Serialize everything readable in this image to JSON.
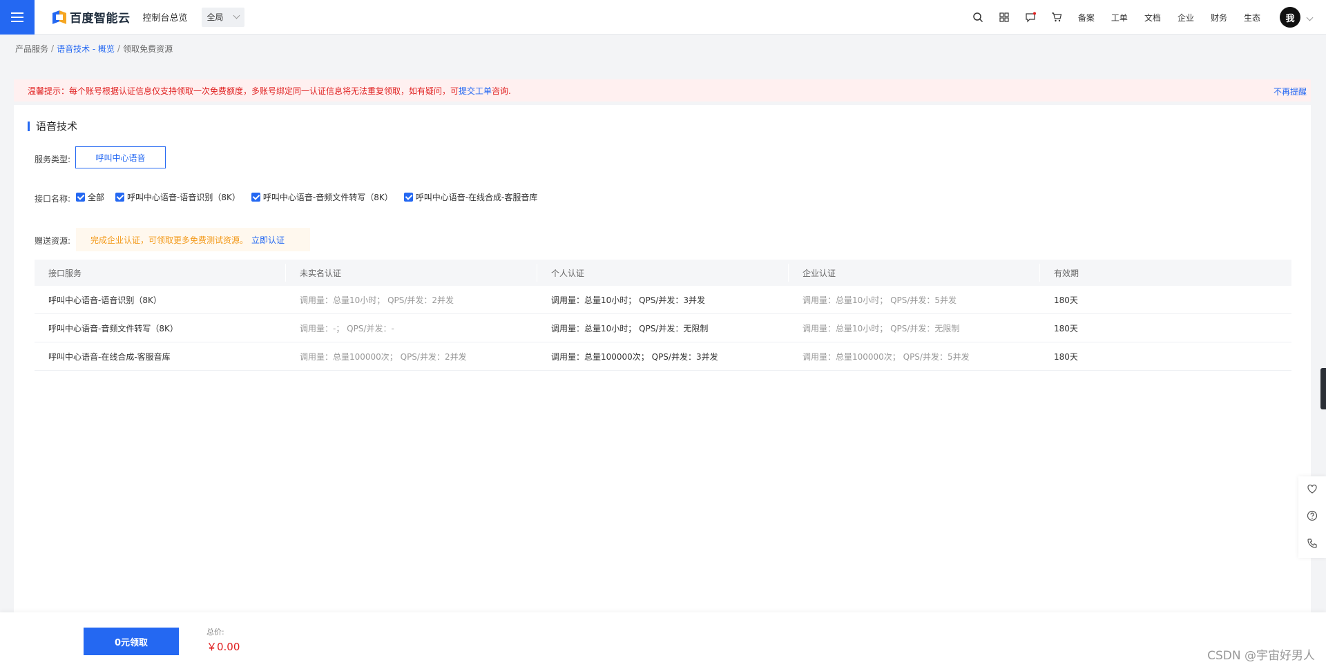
{
  "topbar": {
    "logo_text": "百度智能云",
    "console_link": "控制台总览",
    "region": "全局",
    "nav_links": [
      "备案",
      "工单",
      "文档",
      "企业",
      "财务",
      "生态"
    ],
    "avatar": "我"
  },
  "breadcrumb": {
    "item1": "产品服务",
    "item2": "语音技术 - 概览",
    "item3": "领取免费资源"
  },
  "notice": {
    "text_before": "温馨提示：每个账号根据认证信息仅支持领取一次免费额度，多账号绑定同一认证信息将无法重复领取，如有疑问，可",
    "link": "提交工单",
    "text_after": "咨询.",
    "close": "不再提醒"
  },
  "section": {
    "title": "语音技术",
    "service_type_label": "服务类型:",
    "service_type_value": "呼叫中心语音",
    "api_label": "接口名称:",
    "apis": [
      "全部",
      "呼叫中心语音-语音识别（8K）",
      "呼叫中心语音-音频文件转写（8K）",
      "呼叫中心语音-在线合成-客服音库"
    ],
    "gift_label": "赠送资源:",
    "gift_text": "完成企业认证，可领取更多免费测试资源。",
    "gift_link": "立即认证"
  },
  "table": {
    "headers": [
      "接口服务",
      "未实名认证",
      "个人认证",
      "企业认证",
      "有效期"
    ],
    "rows": [
      [
        "呼叫中心语音-语音识别（8K）",
        "调用量：总量10小时； QPS/并发：2并发",
        "调用量：总量10小时； QPS/并发：3并发",
        "调用量：总量10小时； QPS/并发：5并发",
        "180天"
      ],
      [
        "呼叫中心语音-音频文件转写（8K）",
        "调用量：-； QPS/并发：-",
        "调用量：总量10小时； QPS/并发：无限制",
        "调用量：总量10小时； QPS/并发：无限制",
        "180天"
      ],
      [
        "呼叫中心语音-在线合成-客服音库",
        "调用量：总量100000次； QPS/并发：2并发",
        "调用量：总量100000次； QPS/并发：3并发",
        "调用量：总量100000次； QPS/并发：5并发",
        "180天"
      ]
    ]
  },
  "bottom": {
    "claim_button": "0元领取",
    "total_label": "总价:",
    "total_value": "￥0.00",
    "watermark": "CSDN @宇宙好男人"
  },
  "colors": {
    "accent": "#2468f2",
    "danger": "#e02020",
    "warning": "#f39a1b"
  },
  "icons": [
    "menu-icon",
    "search-icon",
    "grid-icon",
    "message-icon",
    "cart-icon",
    "heart-icon",
    "help-icon",
    "phone-icon"
  ]
}
